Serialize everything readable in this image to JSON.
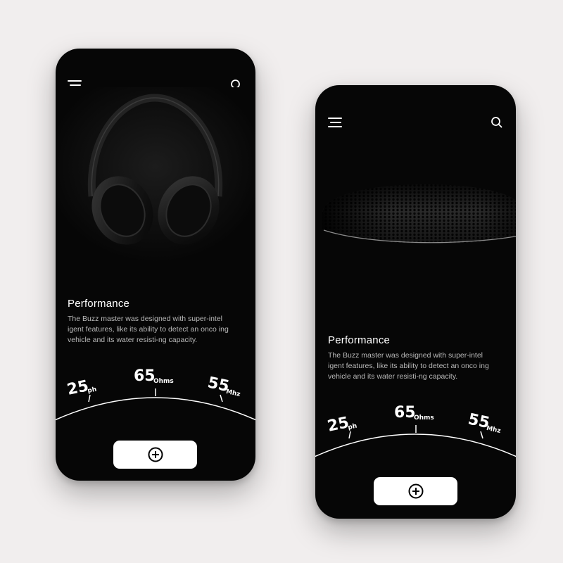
{
  "screens": [
    {
      "id": "headphones",
      "title": "Performance",
      "description": "The Buzz master was designed with super-intel igent features, like its ability to detect an onco ing vehicle and its water resisti-ng capacity.",
      "hero": "headphones-image",
      "specs": [
        {
          "value": "25",
          "unit": "ph"
        },
        {
          "value": "65",
          "unit": "Ohms"
        },
        {
          "value": "55",
          "unit": "Mhz"
        }
      ]
    },
    {
      "id": "speaker",
      "title": "Performance",
      "description": "The Buzz master was designed with super-intel igent features, like its ability to detect an onco ing vehicle and its water resisti-ng capacity.",
      "hero": "speaker-grille-image",
      "specs": [
        {
          "value": "25",
          "unit": "ph"
        },
        {
          "value": "65",
          "unit": "Ohms"
        },
        {
          "value": "55",
          "unit": "Mhz"
        }
      ]
    }
  ],
  "icons": {
    "menu": "menu-icon",
    "search": "search-icon",
    "add": "plus-circle-icon"
  },
  "colors": {
    "background": "#f1eeee",
    "screen": "#060606",
    "text": "#ffffff",
    "muted": "#b9b9b9",
    "button": "#ffffff"
  }
}
